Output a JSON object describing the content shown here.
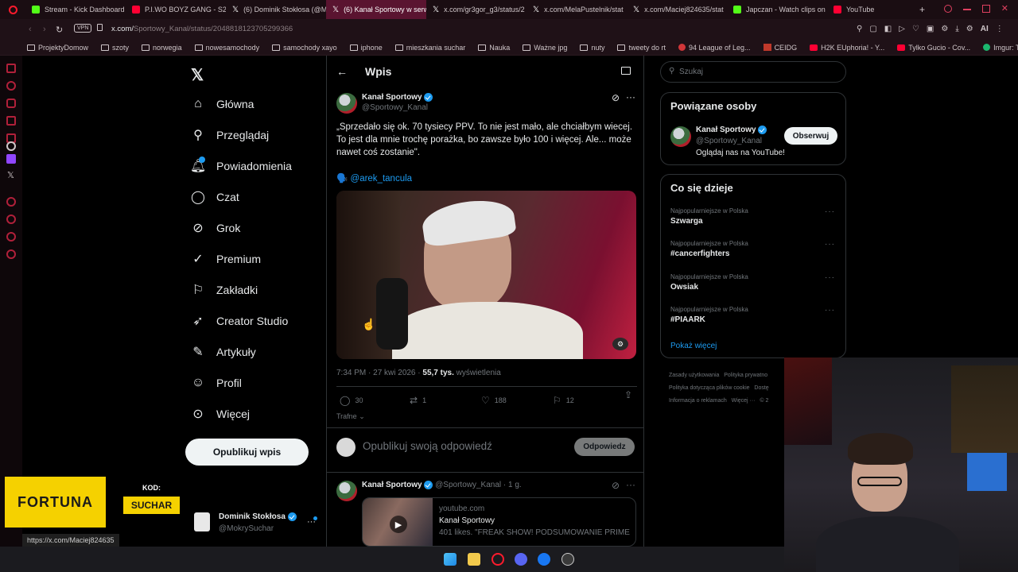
{
  "browser": {
    "tabs": [
      {
        "label": "Stream - Kick Dashboard",
        "color": "#53fc18"
      },
      {
        "label": "P.I.WO BOYZ GANG - S2",
        "color": "#ff0033"
      },
      {
        "label": "(6) Dominik Stokłosa (@M",
        "color": "#ffffff"
      },
      {
        "label": "(6) Kanał Sportowy w serw",
        "color": "#ffffff"
      },
      {
        "label": "x.com/gr3gor_g3/status/2",
        "color": "#ffffff"
      },
      {
        "label": "x.com/MelaPustelnik/stat",
        "color": "#ffffff"
      },
      {
        "label": "x.com/Maciej824635/stat",
        "color": "#ffffff"
      },
      {
        "label": "Japczan - Watch clips on",
        "color": "#53fc18"
      },
      {
        "label": "YouTube",
        "color": "#ff0033"
      }
    ],
    "url_domain": "x.com/",
    "url_path": "Sportowy_Kanal/status/2048818123705299366",
    "vpn": "VPN",
    "ai_label": "AI",
    "bookmarks": [
      "ProjektyDomow",
      "szoty",
      "norwegia",
      "nowesamochody",
      "samochody xayo",
      "iphone",
      "mieszkania suchar",
      "Nauka",
      "Ważne jpg",
      "nuty",
      "tweety do rt",
      "94 League of Leg...",
      "CEIDG",
      "H2K EUphoria! - Y...",
      "Tylko Gucio - Cov...",
      "Imgur: The most a..."
    ],
    "status_url": "https://x.com/Maciej824635"
  },
  "nav": {
    "items": [
      "Główna",
      "Przeglądaj",
      "Powiadomienia",
      "Czat",
      "Grok",
      "Premium",
      "Zakładki",
      "Creator Studio",
      "Artykuły",
      "Profil",
      "Więcej"
    ],
    "post_button": "Opublikuj wpis",
    "account_name": "Dominik Stokłosa",
    "account_handle": "@MokrySuchar"
  },
  "post": {
    "header_title": "Wpis",
    "author_name": "Kanał Sportowy",
    "author_handle": "@Sportowy_Kanal",
    "text": "„Sprzedało się ok. 70 tysiecy PPV. To nie jest mało, ale chciałbym wiecej. To jest dla mnie trochę porażka, bo zawsze było 100 i więcej. Ale... może nawet coś zostanie\".",
    "mention": "🗣️ @arek_tancula",
    "time": "7:34 PM · 27 kwi 2026 · ",
    "views_count": "55,7 tys.",
    "views_label": " wyświetlenia",
    "replies": "30",
    "reposts": "1",
    "likes": "188",
    "bookmarks": "12",
    "sort_label": "Trafne",
    "reply_placeholder": "Opublikuj swoją odpowiedź",
    "reply_button": "Odpowiedz"
  },
  "reply": {
    "author_name": "Kanał Sportowy",
    "author_handle": "@Sportowy_Kanal · 1 g.",
    "card_domain": "youtube.com",
    "card_title": "Kanał Sportowy",
    "card_desc": "401 likes. \"FREAK SHOW! PODSUMOWANIE PRIME:"
  },
  "right": {
    "search_placeholder": "Szukaj",
    "related_title": "Powiązane osoby",
    "related_name": "Kanał Sportowy",
    "related_handle": "@Sportowy_Kanal",
    "related_bio": "Oglądaj nas na YouTube!",
    "follow_button": "Obserwuj",
    "trends_title": "Co się dzieje",
    "trends": [
      {
        "context": "Najpopularniejsze w Polska",
        "name": "Szwarga"
      },
      {
        "context": "Najpopularniejsze w Polska",
        "name": "#cancerfighters"
      },
      {
        "context": "Najpopularniejsze w Polska",
        "name": "Owsiak"
      },
      {
        "context": "Najpopularniejsze w Polska",
        "name": "#PIAARK"
      }
    ],
    "show_more": "Pokaż więcej",
    "footer": [
      "Zasady użytkowania",
      "Polityka prywatno",
      "Polityka dotycząca plików cookie",
      "Dostę",
      "Informacja o reklamach",
      "Więcej ···",
      "© 2"
    ]
  },
  "overlay": {
    "sponsor": "FORTUNA",
    "code_label": "KOD:",
    "code_value": "SUCHAR"
  }
}
